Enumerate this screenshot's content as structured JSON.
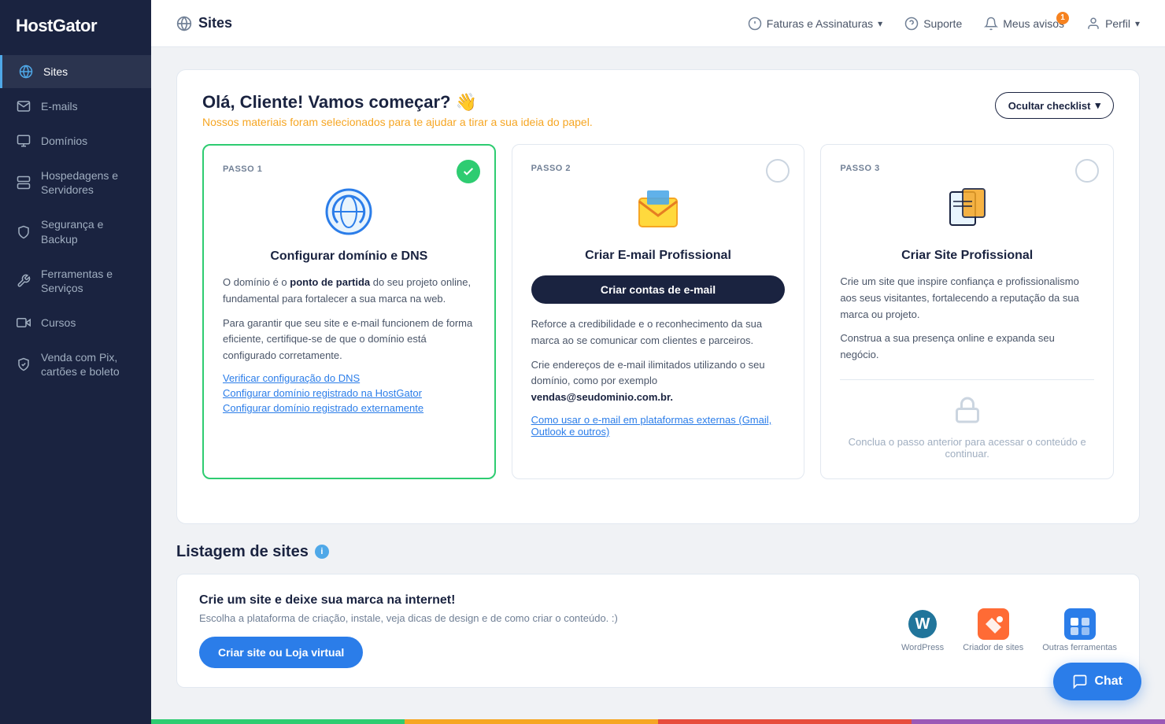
{
  "app": {
    "name": "HostGator"
  },
  "sidebar": {
    "items": [
      {
        "id": "sites",
        "label": "Sites",
        "active": true
      },
      {
        "id": "emails",
        "label": "E-mails",
        "active": false
      },
      {
        "id": "dominios",
        "label": "Domínios",
        "active": false
      },
      {
        "id": "hospedagens",
        "label": "Hospedagens e Servidores",
        "active": false
      },
      {
        "id": "seguranca",
        "label": "Segurança e Backup",
        "active": false
      },
      {
        "id": "ferramentas",
        "label": "Ferramentas e Serviços",
        "active": false
      },
      {
        "id": "cursos",
        "label": "Cursos",
        "active": false
      },
      {
        "id": "venda",
        "label": "Venda com Pix, cartões e boleto",
        "active": false
      }
    ]
  },
  "header": {
    "page_title": "Sites",
    "nav": {
      "faturas": "Faturas e Assinaturas",
      "suporte": "Suporte",
      "avisos": "Meus avisos",
      "avisos_badge": "1",
      "perfil": "Perfil"
    }
  },
  "checklist": {
    "title": "Olá, Cliente! Vamos começar? 👋",
    "subtitle": "Nossos materiais foram selecionados para te ajudar a tirar a sua ideia do papel.",
    "hide_button": "Ocultar checklist",
    "cards": [
      {
        "step": "PASSO 1",
        "title": "Configurar domínio e DNS",
        "status": "done",
        "desc1": "O domínio é o ",
        "desc1_bold": "ponto de partida",
        "desc1_rest": " do seu projeto online, fundamental para fortalecer a sua marca na web.",
        "desc2": "Para garantir que seu site e e-mail funcionem de forma eficiente, certifique-se de que o domínio está configurado corretamente.",
        "links": [
          "Verificar configuração do DNS",
          "Configurar domínio registrado na HostGator",
          "Configurar domínio registrado externamente"
        ]
      },
      {
        "step": "PASSO 2",
        "title": "Criar E-mail Profissional",
        "status": "pending",
        "cta": "Criar contas de e-mail",
        "desc1": "Reforce a credibilidade e o reconhecimento da sua marca ao se comunicar com clientes e parceiros.",
        "desc2": "Crie endereços de e-mail ilimitados utilizando o seu domínio, como por exemplo ",
        "desc2_bold": "vendas@seudominio.com.br.",
        "link": "Como usar o e-mail em plataformas externas (Gmail, Outlook e outros)"
      },
      {
        "step": "PASSO 3",
        "title": "Criar Site Profissional",
        "status": "pending",
        "desc1": "Crie um site que inspire confiança e profissionalismo aos seus visitantes, fortalecendo a reputação da sua marca ou projeto.",
        "desc2": "Construa a sua presença online e expanda seu negócio.",
        "locked_text": "Conclua o passo anterior para acessar o conteúdo e continuar."
      }
    ]
  },
  "listing": {
    "section_title": "Listagem de sites",
    "card_title": "Crie um site e deixe sua marca na internet!",
    "card_subtitle": "Escolha a plataforma de criação, instale, veja dicas de design e de como criar o conteúdo. :)",
    "cta": "Criar site ou Loja virtual",
    "platforms": [
      {
        "id": "wordpress",
        "label": "WordPress"
      },
      {
        "id": "criador",
        "label": "Criador de sites"
      },
      {
        "id": "outras",
        "label": "Outras ferramentas"
      }
    ]
  },
  "chat": {
    "label": "Chat"
  }
}
